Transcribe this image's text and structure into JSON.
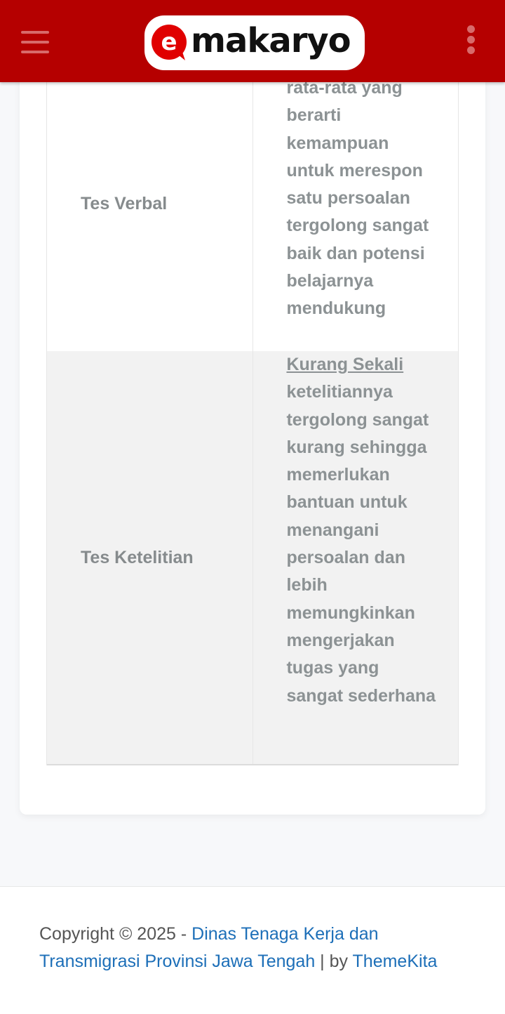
{
  "header": {
    "logo_letter": "e",
    "logo_text": "makaryo",
    "brand_color": "#b50000",
    "menu_icon": "hamburger-icon",
    "more_icon": "kebab-icon"
  },
  "table": {
    "rows": [
      {
        "label": "Tes Verbal",
        "description": "rata-rata yang berarti kemampuan untuk merespon satu persoalan tergolong sangat baik dan potensi belajarnya mendukung"
      },
      {
        "label": "Tes Ketelitian",
        "level": "Kurang Sekali",
        "description": "ketelitiannya tergolong sangat kurang sehingga memerlukan bantuan untuk menangani persoalan dan lebih memungkinkan mengerjakan tugas yang sangat sederhana"
      }
    ]
  },
  "footer": {
    "copyright": "Copyright © 2025 - ",
    "org_link": "Dinas Tenaga Kerja dan Transmigrasi Provinsi Jawa Tengah",
    "separator": " | by ",
    "theme_link": "ThemeKita",
    "link_color": "#1d6fb8"
  }
}
